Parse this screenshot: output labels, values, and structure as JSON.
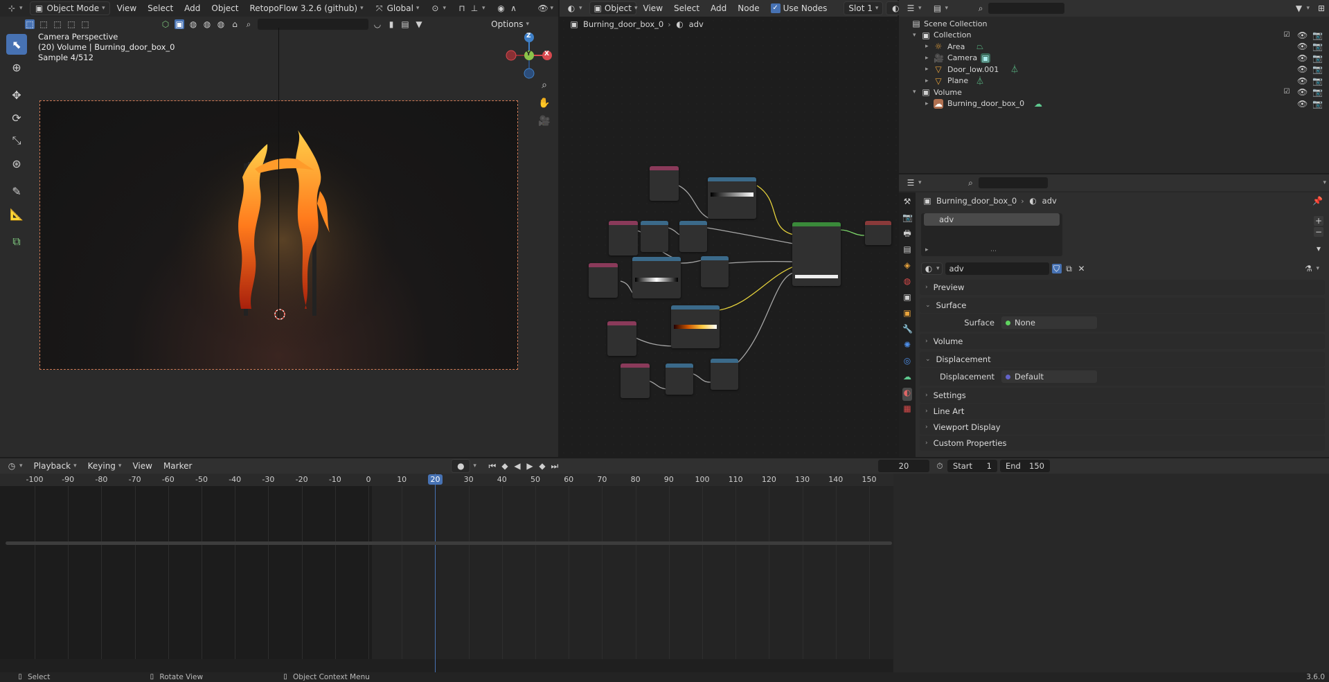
{
  "viewport": {
    "header": {
      "mode": "Object Mode",
      "menus": [
        "View",
        "Select",
        "Add",
        "Object"
      ],
      "addon": "RetopoFlow 3.2.6 (github)",
      "transform": "Global",
      "options": "Options"
    },
    "overlay": {
      "line1": "Camera Perspective",
      "line2": "(20) Volume | Burning_door_box_0",
      "line3": "Sample 4/512"
    },
    "gizmo": {
      "x": "X",
      "y": "Y",
      "z": "Z"
    }
  },
  "node_editor": {
    "header": {
      "type": "Object",
      "menus": [
        "View",
        "Select",
        "Add",
        "Node"
      ],
      "use_nodes": "Use Nodes",
      "slot": "Slot 1",
      "material": "adv"
    },
    "breadcrumb": {
      "object": "Burning_door_box_0",
      "material": "adv"
    }
  },
  "outliner": {
    "scene_collection": "Scene Collection",
    "collection": "Collection",
    "items": [
      {
        "name": "Area",
        "color": "#e8a33c"
      },
      {
        "name": "Camera",
        "color": "#e8a33c"
      },
      {
        "name": "Door_low.001",
        "color": "#e8a33c"
      },
      {
        "name": "Plane",
        "color": "#e8a33c"
      }
    ],
    "volume_collection": "Volume",
    "volume_item": "Burning_door_box_0"
  },
  "properties": {
    "breadcrumb": {
      "object": "Burning_door_box_0",
      "material": "adv"
    },
    "slot_item": "adv",
    "material_name": "adv",
    "panels": {
      "preview": "Preview",
      "surface": "Surface",
      "surface_label": "Surface",
      "surface_value": "None",
      "volume": "Volume",
      "displacement": "Displacement",
      "displacement_label": "Displacement",
      "displacement_value": "Default",
      "settings": "Settings",
      "line_art": "Line Art",
      "viewport_display": "Viewport Display",
      "custom_properties": "Custom Properties"
    }
  },
  "timeline": {
    "header": {
      "menus": [
        "Playback",
        "Keying",
        "View",
        "Marker"
      ],
      "current_frame": "20",
      "start_label": "Start",
      "start": "1",
      "end_label": "End",
      "end": "150"
    },
    "ruler": [
      "-100",
      "-90",
      "-80",
      "-70",
      "-60",
      "-50",
      "-40",
      "-30",
      "-20",
      "-10",
      "0",
      "10",
      "20",
      "30",
      "40",
      "50",
      "60",
      "70",
      "80",
      "90",
      "100",
      "110",
      "120",
      "130",
      "140",
      "150"
    ],
    "current": "20"
  },
  "statusbar": {
    "select": "Select",
    "rotate": "Rotate View",
    "context": "Object Context Menu",
    "version": "3.6.0"
  },
  "colors": {
    "accent": "#4772b3",
    "header": "#303030",
    "panel": "#2b2b2b"
  }
}
